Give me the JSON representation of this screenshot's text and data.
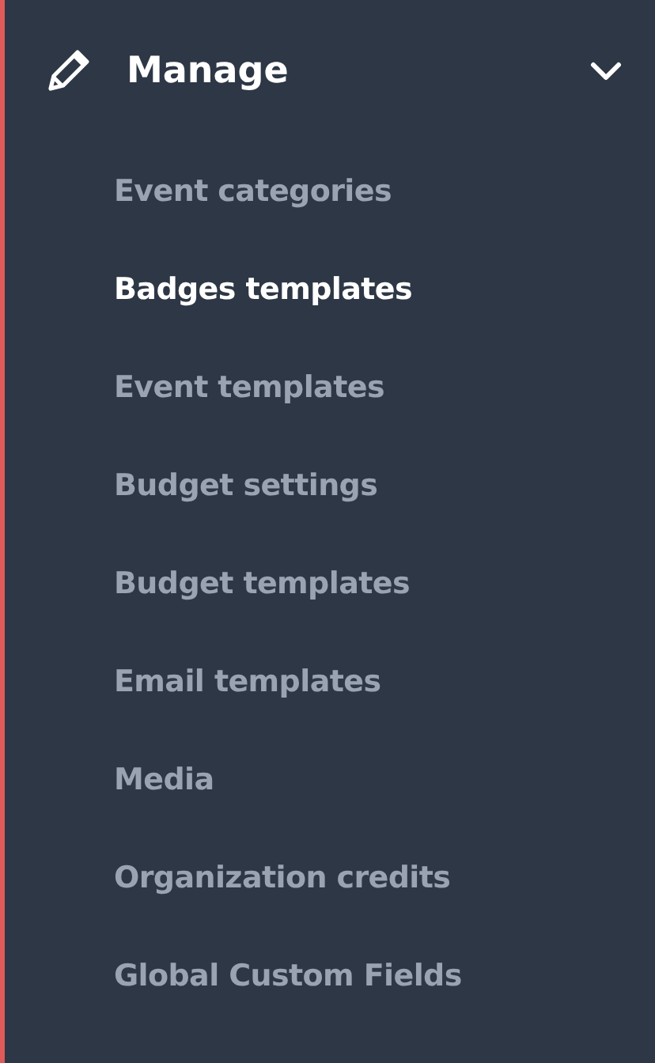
{
  "section": {
    "title": "Manage",
    "expanded": true,
    "items": [
      {
        "label": "Event categories",
        "selected": false
      },
      {
        "label": "Badges templates",
        "selected": true
      },
      {
        "label": "Event templates",
        "selected": false
      },
      {
        "label": "Budget settings",
        "selected": false
      },
      {
        "label": "Budget templates",
        "selected": false
      },
      {
        "label": "Email templates",
        "selected": false
      },
      {
        "label": "Media",
        "selected": false
      },
      {
        "label": "Organization credits",
        "selected": false
      },
      {
        "label": "Global Custom Fields",
        "selected": false
      }
    ]
  }
}
